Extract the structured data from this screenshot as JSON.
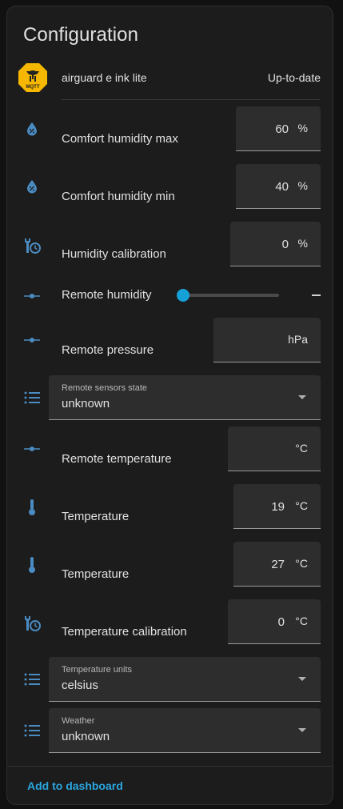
{
  "header": {
    "title": "Configuration"
  },
  "device": {
    "name": "airguard e ink lite",
    "status": "Up-to-date",
    "logo_text": "MQTT"
  },
  "rows": {
    "comfort_humidity_max": {
      "label": "Comfort humidity max",
      "value": "60",
      "unit": "%",
      "icon": "water-percent-icon"
    },
    "comfort_humidity_min": {
      "label": "Comfort humidity min",
      "value": "40",
      "unit": "%",
      "icon": "water-percent-icon"
    },
    "humidity_calibration": {
      "label": "Humidity calibration",
      "value": "0",
      "unit": "%",
      "icon": "wrench-clock-icon"
    },
    "remote_humidity": {
      "label": "Remote humidity",
      "value": "—",
      "icon": "ray-vertex-icon",
      "slider_fraction": 0
    },
    "remote_pressure": {
      "label": "Remote pressure",
      "value": "",
      "unit": "hPa",
      "icon": "ray-vertex-icon"
    },
    "remote_sensors_state": {
      "label": "Remote sensors state",
      "value": "unknown",
      "icon": "format-list-bulleted-icon"
    },
    "remote_temperature": {
      "label": "Remote temperature",
      "value": "",
      "unit": "°C",
      "icon": "ray-vertex-icon"
    },
    "temperature_1": {
      "label": "Temperature",
      "value": "19",
      "unit": "°C",
      "icon": "thermometer-icon"
    },
    "temperature_2": {
      "label": "Temperature",
      "value": "27",
      "unit": "°C",
      "icon": "thermometer-icon"
    },
    "temperature_calibration": {
      "label": "Temperature calibration",
      "value": "0",
      "unit": "°C",
      "icon": "wrench-clock-icon"
    },
    "temperature_units": {
      "label": "Temperature units",
      "value": "celsius",
      "icon": "format-list-bulleted-icon"
    },
    "weather": {
      "label": "Weather",
      "value": "unknown",
      "icon": "format-list-bulleted-icon"
    }
  },
  "footer": {
    "add_label": "Add to dashboard"
  },
  "colors": {
    "accent": "#2aa6e0",
    "icon": "#4a8bc2",
    "card": "#1c1c1c",
    "field": "#2d2d2d"
  }
}
